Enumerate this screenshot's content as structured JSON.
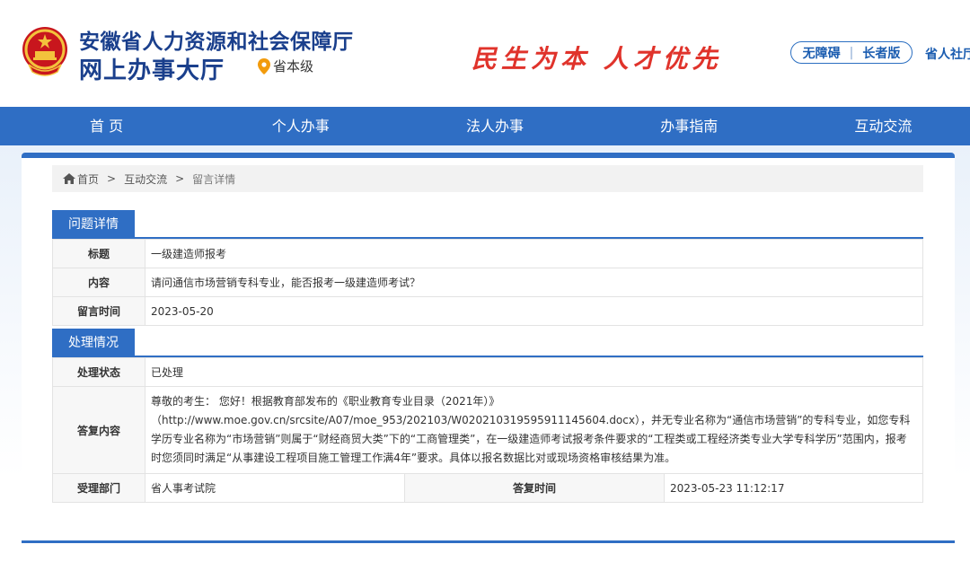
{
  "header": {
    "site_title": "安徽省人力资源和社会保障厅",
    "site_subtitle": "网上办事大厅",
    "location": "省本级",
    "slogan": "民生为本 人才优先",
    "accessibility": "无障碍",
    "elder_mode": "长者版",
    "dept_link": "省人社厅"
  },
  "nav": {
    "items": [
      "首 页",
      "个人办事",
      "法人办事",
      "办事指南",
      "互动交流"
    ]
  },
  "breadcrumb": {
    "home": "首页",
    "sep": ">",
    "level1": "互动交流",
    "level2": "留言详情"
  },
  "question": {
    "section_title": "问题详情",
    "title_label": "标题",
    "title_value": "一级建造师报考",
    "content_label": "内容",
    "content_value": "请问通信市场营销专科专业，能否报考一级建造师考试？",
    "time_label": "留言时间",
    "time_value": "2023-05-20"
  },
  "handling": {
    "section_title": "处理情况",
    "status_label": "处理状态",
    "status_value": "已处理",
    "reply_label": "答复内容",
    "reply_line1": "尊敬的考生： 您好！根据教育部发布的《职业教育专业目录（2021年）》",
    "reply_line2": "（http://www.moe.gov.cn/srcsite/A07/moe_953/202103/W020210319595911145604.docx），并无专业名称为“通信市场营销”的专科专业，如您专科学历专业名称为“市场营销”则属于“财经商贸大类”下的“工商管理类”，在一级建造师考试报考条件要求的“工程类或工程经济类专业大学专科学历”范围内，报考时您须同时满足“从事建设工程项目施工管理工作满4年”要求。具体以报名数据比对或现场资格审核结果为准。",
    "dept_label": "受理部门",
    "dept_value": "省人事考试院",
    "reply_time_label": "答复时间",
    "reply_time_value": "2023-05-23 11:12:17"
  },
  "colors": {
    "brand_blue": "#2f6ec4",
    "title_blue": "#1a3f8c",
    "slogan_red": "#e0332b"
  }
}
